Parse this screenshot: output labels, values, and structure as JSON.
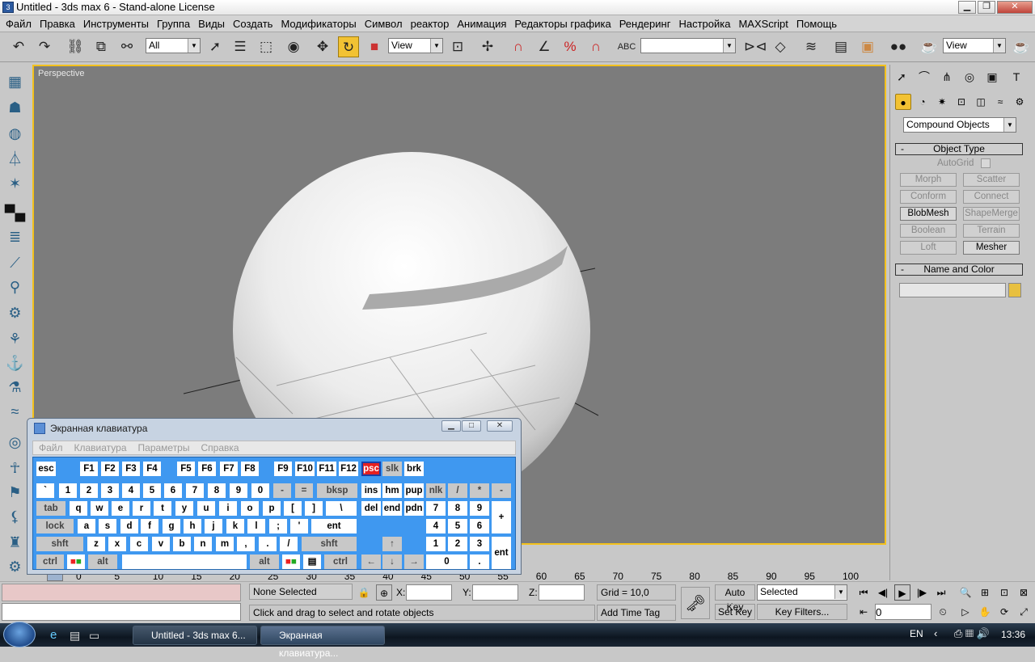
{
  "window": {
    "title": "Untitled - 3ds max 6 - Stand-alone License",
    "app_icon": "3ds-max-icon"
  },
  "menu": [
    "Файл",
    "Правка",
    "Инструменты",
    "Группа",
    "Виды",
    "Создать",
    "Модификаторы",
    "Символ",
    "реактор",
    "Анимация",
    "Редакторы графика",
    "Рендеринг",
    "Настройка",
    "MAXScript",
    "Помощь"
  ],
  "toolbar": {
    "selection_filter": "All",
    "ref_coord": "View",
    "named_sel": "",
    "view_dropdown": "View"
  },
  "viewport": {
    "label": "Perspective"
  },
  "command_panel": {
    "category": "Compound Objects",
    "object_type_title": "Object Type",
    "autogrid_label": "AutoGrid",
    "buttons": [
      {
        "label": "Morph",
        "enabled": false
      },
      {
        "label": "Scatter",
        "enabled": false
      },
      {
        "label": "Conform",
        "enabled": false
      },
      {
        "label": "Connect",
        "enabled": false
      },
      {
        "label": "BlobMesh",
        "enabled": true
      },
      {
        "label": "ShapeMerge",
        "enabled": false
      },
      {
        "label": "Boolean",
        "enabled": false
      },
      {
        "label": "Terrain",
        "enabled": false
      },
      {
        "label": "Loft",
        "enabled": false
      },
      {
        "label": "Mesher",
        "enabled": true
      }
    ],
    "name_color_title": "Name and Color",
    "name_value": "",
    "object_color": "#e8c040"
  },
  "timeline": {
    "ticks": [
      "0",
      "5",
      "10",
      "15",
      "20",
      "25",
      "30",
      "35",
      "40",
      "45",
      "50",
      "55",
      "60",
      "65",
      "70",
      "75",
      "80",
      "85",
      "90",
      "95",
      "100"
    ]
  },
  "status": {
    "selection": "None Selected",
    "x_label": "X:",
    "y_label": "Y:",
    "z_label": "Z:",
    "x": "",
    "y": "",
    "z": "",
    "grid": "Grid = 10,0",
    "prompt": "Click and drag to select and rotate objects",
    "add_time_tag": "Add Time Tag",
    "auto_key": "Auto Key",
    "set_key": "Set Key",
    "key_mode": "Selected",
    "key_filters": "Key Filters...",
    "frame": "0"
  },
  "osk": {
    "title": "Экранная клавиатура",
    "menu": [
      "Файл",
      "Клавиатура",
      "Параметры",
      "Справка"
    ],
    "row0": [
      "esc",
      "F1",
      "F2",
      "F3",
      "F4",
      "F5",
      "F6",
      "F7",
      "F8",
      "F9",
      "F10",
      "F11",
      "F12",
      "psc",
      "slk",
      "brk"
    ],
    "row1": [
      "`",
      "1",
      "2",
      "3",
      "4",
      "5",
      "6",
      "7",
      "8",
      "9",
      "0",
      "-",
      "=",
      "bksp",
      "ins",
      "hm",
      "pup",
      "nlk",
      "/",
      "*",
      "-"
    ],
    "row2": [
      "tab",
      "q",
      "w",
      "e",
      "r",
      "t",
      "y",
      "u",
      "i",
      "o",
      "p",
      "[",
      "]",
      "\\",
      "del",
      "end",
      "pdn",
      "7",
      "8",
      "9",
      "+"
    ],
    "row3": [
      "lock",
      "a",
      "s",
      "d",
      "f",
      "g",
      "h",
      "j",
      "k",
      "l",
      ";",
      "'",
      "ent",
      "4",
      "5",
      "6"
    ],
    "row4": [
      "shft",
      "z",
      "x",
      "c",
      "v",
      "b",
      "n",
      "m",
      ",",
      ".",
      "/",
      "shft",
      "1",
      "2",
      "3",
      "ent"
    ],
    "row5": [
      "ctrl",
      "alt",
      "alt",
      "ctrl",
      "0",
      "."
    ]
  },
  "taskbar": {
    "tasks": [
      "Untitled - 3ds max 6...",
      "Экранная клавиатура..."
    ],
    "lang": "EN",
    "clock": "13:36"
  }
}
